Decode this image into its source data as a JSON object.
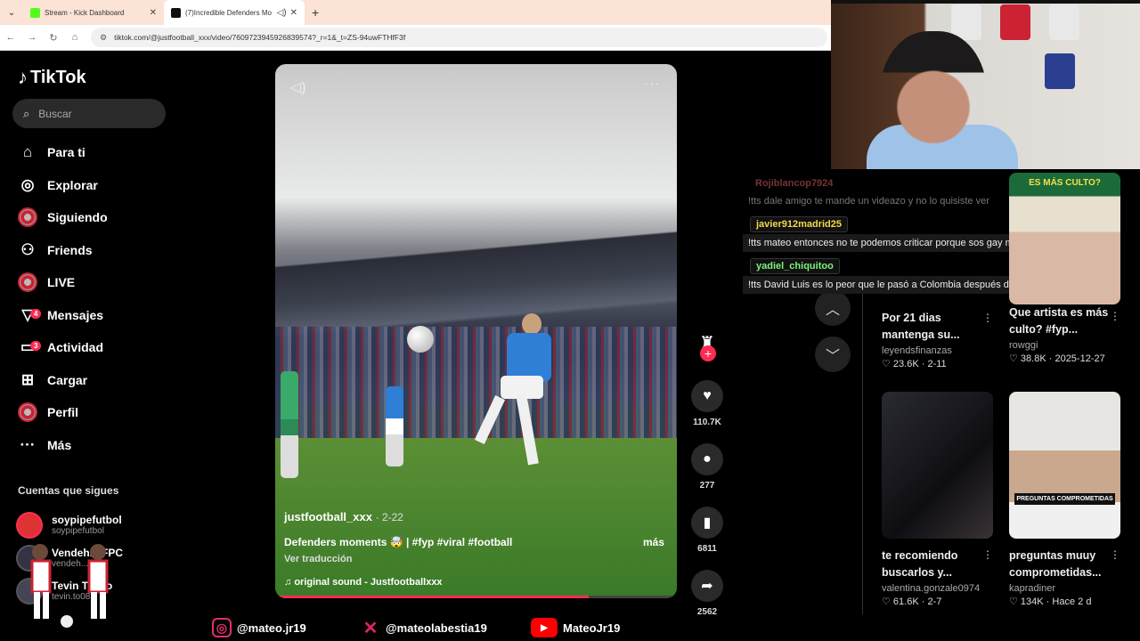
{
  "browser": {
    "tabs": [
      {
        "title": "Stream - Kick Dashboard",
        "favicon_color": "#53fc18"
      },
      {
        "title": "(7)Incredible Defenders Mo",
        "favicon_color": "#111111"
      }
    ],
    "url": "tiktok.com/@justfootball_xxx/video/7609723945926839574?_r=1&_t=ZS-94uwFTHfF3f"
  },
  "sidebar": {
    "logo": "TikTok",
    "search_placeholder": "Buscar",
    "nav": [
      {
        "label": "Para ti",
        "icon": "home-icon",
        "glyph": "⌂",
        "badge": ""
      },
      {
        "label": "Explorar",
        "icon": "compass-icon",
        "glyph": "◎",
        "badge": ""
      },
      {
        "label": "Siguiendo",
        "icon": "following-avatar-icon",
        "glyph": "",
        "badge": ""
      },
      {
        "label": "Friends",
        "icon": "friends-icon",
        "glyph": "⚇",
        "badge": ""
      },
      {
        "label": "LIVE",
        "icon": "live-avatar-icon",
        "glyph": "",
        "badge": ""
      },
      {
        "label": "Mensajes",
        "icon": "messages-icon",
        "glyph": "▽",
        "badge": "4"
      },
      {
        "label": "Actividad",
        "icon": "activity-icon",
        "glyph": "▭",
        "badge": "3"
      },
      {
        "label": "Cargar",
        "icon": "upload-icon",
        "glyph": "⊞",
        "badge": ""
      },
      {
        "label": "Perfil",
        "icon": "profile-avatar-icon",
        "glyph": "",
        "badge": ""
      },
      {
        "label": "Más",
        "icon": "more-icon",
        "glyph": "···",
        "badge": ""
      }
    ],
    "following_title": "Cuentas que sigues",
    "following": [
      {
        "name": "soypipefutbol",
        "handle": "soypipefutbol"
      },
      {
        "name": "Vendeh... FPC",
        "handle": "vendeh..."
      },
      {
        "name": "Tevin To... o",
        "handle": "tevin.to08"
      }
    ]
  },
  "video": {
    "author": "justfootball_xxx",
    "date": "2-22",
    "caption": "Defenders moments 🤯 | #fyp #viral #football",
    "more": "más",
    "translate": "Ver traducción",
    "sound": "original sound - Justfootballxxx",
    "progress": 0.78
  },
  "actions": {
    "likes": "110.7K",
    "comments": "277",
    "saves": "6811",
    "shares": "2562"
  },
  "chat": [
    {
      "user": "Rojiblancop7924",
      "message": "!tts dale amigo te mande un videazo y no lo quisiste ver",
      "faded": true,
      "color": "yellow"
    },
    {
      "user": "javier912madrid25",
      "message": "!tts mateo entonces no te podemos criticar porque sos gay mateo",
      "faded": false,
      "color": "yellow"
    },
    {
      "user": "yadiel_chiquitoo",
      "message": "!tts David Luis es lo peor que le pasó a Colombia después de Lautaro",
      "faded": false,
      "color": "green"
    }
  ],
  "cards": [
    {
      "title": "Por 21 dias mantenga su...",
      "author": "leyendsfinanzas",
      "likes": "23.6K",
      "date": "2-11"
    },
    {
      "title": "Que artista es más culto? #fyp...",
      "author": "rowggi",
      "likes": "38.8K",
      "date": "2025-12-27",
      "thumb_text": "ES MÁS CULTO?"
    },
    {
      "title": "te recomiendo buscarlos y...",
      "author": "valentina.gonzale0974",
      "likes": "61.6K",
      "date": "2-7"
    },
    {
      "title": "preguntas muuy comprometidas...",
      "author": "kapradiner",
      "likes": "134K",
      "date": "Hace 2 d",
      "thumb_text": "PREGUNTAS COMPROMETIDAS"
    }
  ],
  "socials": [
    {
      "handle": "@mateo.jr19",
      "icon": "instagram-icon",
      "color": "#e1306c"
    },
    {
      "handle": "@mateolabestia19",
      "icon": "x-icon",
      "color": "#e0245e"
    },
    {
      "handle": "MateoJr19",
      "icon": "youtube-icon",
      "color": "#ff0000"
    }
  ]
}
